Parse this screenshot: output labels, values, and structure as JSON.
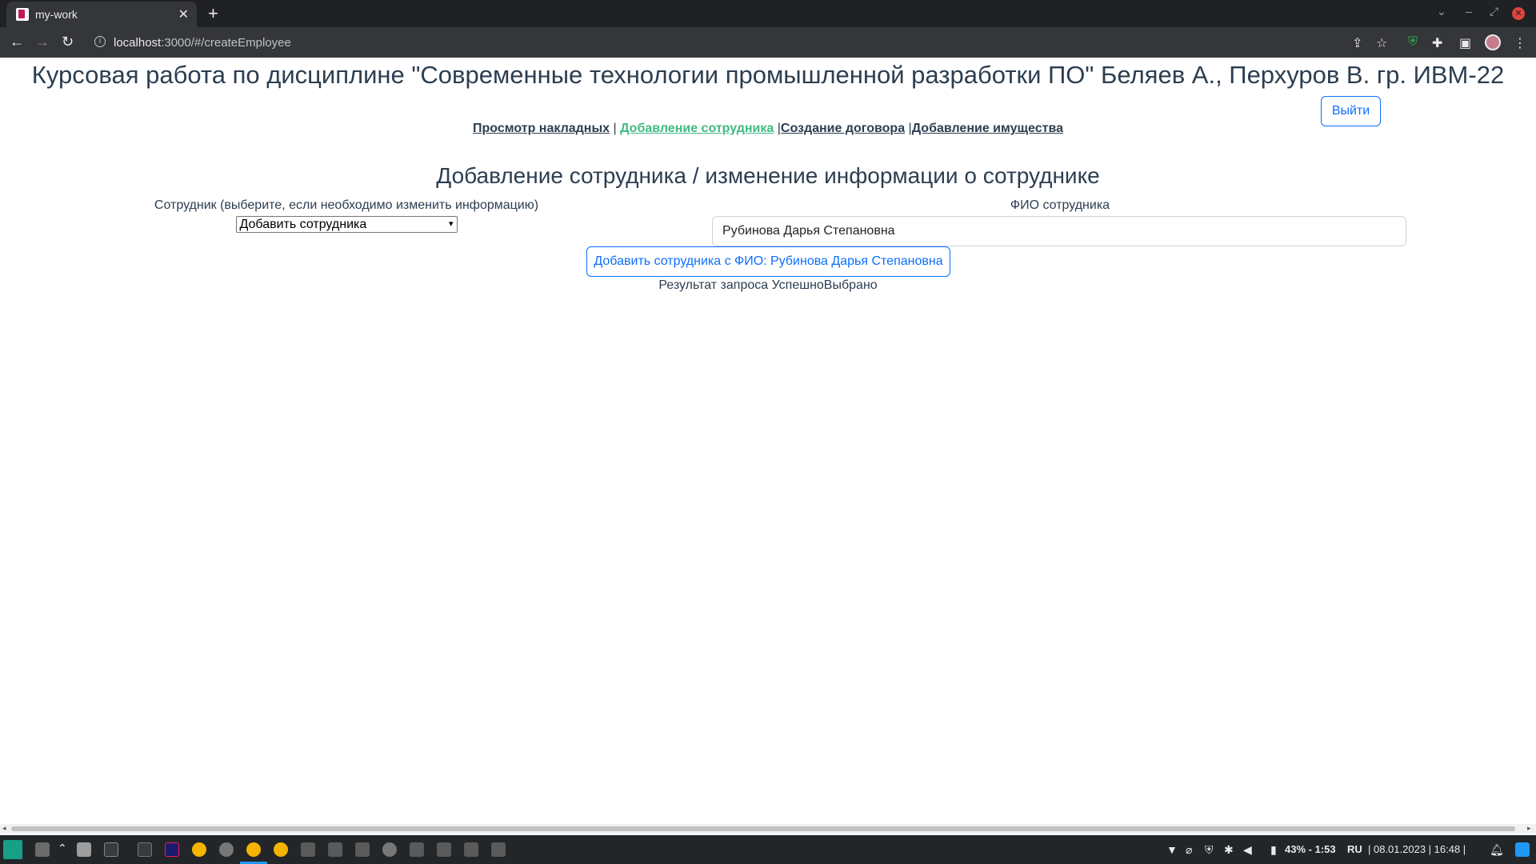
{
  "browser": {
    "tab_title": "my-work",
    "url_host": "localhost",
    "url_rest": ":3000/#/createEmployee"
  },
  "page": {
    "heading": "Курсовая работа по дисциплине \"Современные технологии промышленной разработки ПО\" Беляев А., Перхуров В. гр. ИВМ-22",
    "logout_label": "Выйти",
    "nav": [
      {
        "label": "Просмотр накладных",
        "active": false
      },
      {
        "label": "Добавление сотрудника",
        "active": true
      },
      {
        "label": "Создание договора",
        "active": false
      },
      {
        "label": "Добавление имущества",
        "active": false
      }
    ],
    "form_title": "Добавление сотрудника / изменение информации о сотруднике",
    "employee_select_label": "Сотрудник (выберите, если необходимо изменить информацию)",
    "employee_select_value": "Добавить сотрудника",
    "fio_label": "ФИО сотрудника",
    "fio_value": "Рубинова Дарья Степановна",
    "submit_label": "Добавить сотрудника с ФИО: Рубинова Дарья Степановна",
    "result_text": "Результат запроса УспешноВыбрано"
  },
  "taskbar": {
    "battery": "43% - 1:53",
    "lang": "RU",
    "datetime": "| 08.01.2023 | 16:48 |"
  }
}
